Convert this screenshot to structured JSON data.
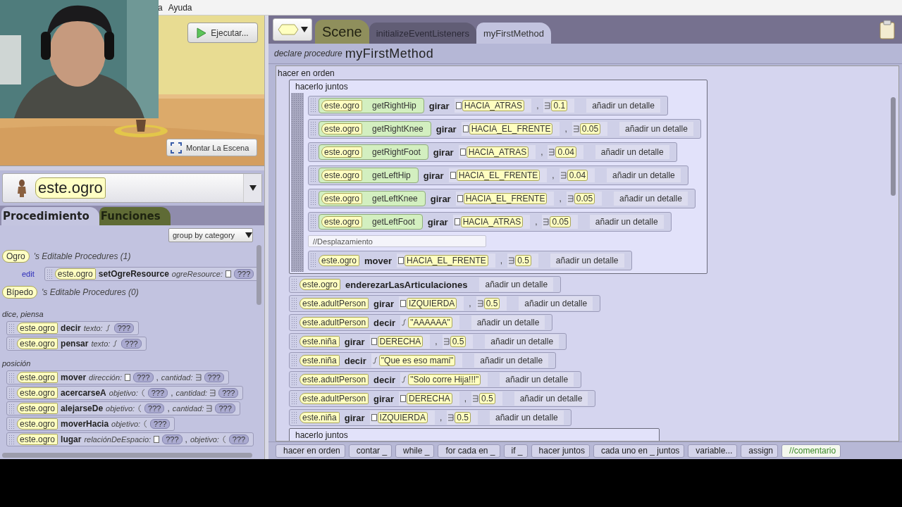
{
  "menu": [
    "a",
    "Ayuda"
  ],
  "scene": {
    "run_button": "Ejecutar...",
    "setup_button": "Montar La Escena"
  },
  "object_selector": {
    "value": "este.ogro"
  },
  "palette_tabs": [
    {
      "label": "Procedimiento",
      "selected": true
    },
    {
      "label": "Funciones",
      "selected": false
    }
  ],
  "group_dropdown": {
    "value": "group by category"
  },
  "palette": [
    {
      "kind": "class",
      "class": "Ogro",
      "text": "'s Editable Procedures (1)"
    },
    {
      "kind": "method",
      "edit": "edit",
      "target": "este.ogro",
      "name": "setOgreResource",
      "params": [
        {
          "label": "ogreResource:",
          "kind": "enum",
          "value": "???"
        }
      ]
    },
    {
      "kind": "class",
      "class": "Bípedo",
      "text": "'s Editable Procedures (0)"
    },
    {
      "kind": "category",
      "text": "dice, piensa"
    },
    {
      "kind": "method",
      "target": "este.ogro",
      "name": "decir",
      "params": [
        {
          "label": "texto:",
          "kind": "string",
          "value": "???"
        }
      ]
    },
    {
      "kind": "method",
      "target": "este.ogro",
      "name": "pensar",
      "params": [
        {
          "label": "texto:",
          "kind": "string",
          "value": "???"
        }
      ]
    },
    {
      "kind": "category",
      "text": "posición"
    },
    {
      "kind": "method",
      "target": "este.ogro",
      "name": "mover",
      "params": [
        {
          "label": "dirección:",
          "kind": "enum",
          "value": "???"
        },
        {
          "lead": ",",
          "label": "cantidad:",
          "kind": "number",
          "value": "???"
        }
      ]
    },
    {
      "kind": "method",
      "target": "este.ogro",
      "name": "acercarseA",
      "params": [
        {
          "label": "objetivo:",
          "kind": "object",
          "value": "???"
        },
        {
          "lead": ",",
          "label": "cantidad:",
          "kind": "number",
          "value": "???"
        }
      ]
    },
    {
      "kind": "method",
      "target": "este.ogro",
      "name": "alejarseDe",
      "params": [
        {
          "label": "objetivo:",
          "kind": "object",
          "value": "???"
        },
        {
          "lead": ",",
          "label": "cantidad:",
          "kind": "number",
          "value": "???"
        }
      ]
    },
    {
      "kind": "method",
      "target": "este.ogro",
      "name": "moverHacia",
      "params": [
        {
          "label": "objetivo:",
          "kind": "object",
          "value": "???"
        }
      ]
    },
    {
      "kind": "method",
      "target": "este.ogro",
      "name": "lugar",
      "params": [
        {
          "label": "relaciónDeEspacio:",
          "kind": "enum",
          "value": "???"
        },
        {
          "lead": ",",
          "label": "objetivo:",
          "kind": "object",
          "value": "???"
        }
      ]
    }
  ],
  "editor_tabs": [
    {
      "label": "Scene",
      "kind": "class",
      "selected": false
    },
    {
      "label": "initializeEventListeners",
      "kind": "method",
      "selected": false
    },
    {
      "label": "myFirstMethod",
      "kind": "method",
      "selected": true
    }
  ],
  "declare": {
    "prefix": "declare procedure",
    "name": "myFirstMethod"
  },
  "body": {
    "label": "hacer en orden",
    "statements": [
      {
        "kind": "together",
        "label": "hacerlo juntos",
        "statements": [
          {
            "kind": "call",
            "target": "este.ogro",
            "getter": "getRightHip",
            "verb": "girar",
            "args": [
              {
                "kind": "enum",
                "value": "HACIA_ATRAS"
              },
              {
                "kind": "number",
                "lead": ",",
                "value": "0.1"
              }
            ],
            "detail": "añadir un detalle"
          },
          {
            "kind": "call",
            "target": "este.ogro",
            "getter": "getRightKnee",
            "verb": "girar",
            "args": [
              {
                "kind": "enum",
                "value": "HACIA_EL_FRENTE"
              },
              {
                "kind": "number",
                "lead": ",",
                "value": "0.05"
              }
            ],
            "detail": "añadir un detalle"
          },
          {
            "kind": "call",
            "target": "este.ogro",
            "getter": "getRightFoot",
            "verb": "girar",
            "args": [
              {
                "kind": "enum",
                "value": "HACIA_ATRAS"
              },
              {
                "kind": "number",
                "lead": ",",
                "value": "0.04"
              }
            ],
            "detail": "añadir un detalle"
          },
          {
            "kind": "call",
            "target": "este.ogro",
            "getter": "getLeftHip",
            "verb": "girar",
            "args": [
              {
                "kind": "enum",
                "value": "HACIA_EL_FRENTE"
              },
              {
                "kind": "number",
                "lead": ",",
                "value": "0.04"
              }
            ],
            "detail": "añadir un detalle"
          },
          {
            "kind": "call",
            "target": "este.ogro",
            "getter": "getLeftKnee",
            "verb": "girar",
            "args": [
              {
                "kind": "enum",
                "value": "HACIA_EL_FRENTE"
              },
              {
                "kind": "number",
                "lead": ",",
                "value": "0.05"
              }
            ],
            "detail": "añadir un detalle"
          },
          {
            "kind": "call",
            "target": "este.ogro",
            "getter": "getLeftFoot",
            "verb": "girar",
            "args": [
              {
                "kind": "enum",
                "value": "HACIA_ATRAS"
              },
              {
                "kind": "number",
                "lead": ",",
                "value": "0.05"
              }
            ],
            "detail": "añadir un detalle"
          },
          {
            "kind": "comment",
            "text": "//Desplazamiento"
          },
          {
            "kind": "call",
            "target": "este.ogro",
            "verb": "mover",
            "args": [
              {
                "kind": "enum",
                "value": "HACIA_EL_FRENTE"
              },
              {
                "kind": "number",
                "lead": ",",
                "value": "0.5"
              }
            ],
            "detail": "añadir un detalle"
          }
        ]
      },
      {
        "kind": "call",
        "target": "este.ogro",
        "verb": "enderezarLasArticulaciones",
        "detail": "añadir un detalle"
      },
      {
        "kind": "call",
        "target": "este.adultPerson",
        "verb": "girar",
        "args": [
          {
            "kind": "enum",
            "value": "IZQUIERDA"
          },
          {
            "kind": "number",
            "lead": ",",
            "value": "0.5"
          }
        ],
        "detail": "añadir un detalle"
      },
      {
        "kind": "call",
        "target": "este.adultPerson",
        "verb": "decir",
        "args": [
          {
            "kind": "string",
            "value": "\"AAAAAA\""
          }
        ],
        "detail": "añadir un detalle"
      },
      {
        "kind": "call",
        "target": "este.niña",
        "verb": "girar",
        "args": [
          {
            "kind": "enum",
            "value": "DERECHA"
          },
          {
            "kind": "number",
            "lead": ",",
            "value": "0.5"
          }
        ],
        "detail": "añadir un detalle"
      },
      {
        "kind": "call",
        "target": "este.niña",
        "verb": "decir",
        "args": [
          {
            "kind": "string",
            "value": "\"Que es eso mami\""
          }
        ],
        "detail": "añadir un detalle"
      },
      {
        "kind": "call",
        "target": "este.adultPerson",
        "verb": "decir",
        "args": [
          {
            "kind": "string",
            "value": "\"Solo corre Hija!!!\""
          }
        ],
        "detail": "añadir un detalle"
      },
      {
        "kind": "call",
        "target": "este.adultPerson",
        "verb": "girar",
        "args": [
          {
            "kind": "enum",
            "value": "DERECHA"
          },
          {
            "kind": "number",
            "lead": ",",
            "value": "0.5"
          }
        ],
        "detail": "añadir un detalle"
      },
      {
        "kind": "call",
        "target": "este.niña",
        "verb": "girar",
        "args": [
          {
            "kind": "enum",
            "value": "IZQUIERDA"
          },
          {
            "kind": "number",
            "lead": ",",
            "value": "0.5"
          }
        ],
        "detail": "añadir un detalle"
      },
      {
        "kind": "together",
        "label": "hacerlo juntos"
      }
    ]
  },
  "control_bar": [
    {
      "label": "hacer en orden",
      "kind": "control"
    },
    {
      "label": "contar _",
      "kind": "control"
    },
    {
      "label": "while _",
      "kind": "control"
    },
    {
      "label": "for cada en _",
      "kind": "control"
    },
    {
      "label": "if _",
      "kind": "control"
    },
    {
      "label": "hacer juntos",
      "kind": "control"
    },
    {
      "label": "cada uno en _ juntos",
      "kind": "control"
    },
    {
      "label": "variable...",
      "kind": "control"
    },
    {
      "label": "assign",
      "kind": "control"
    },
    {
      "label": "//comentario",
      "kind": "comment"
    }
  ]
}
